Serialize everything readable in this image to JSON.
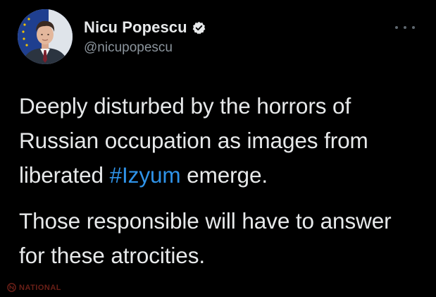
{
  "author": {
    "display_name": "Nicu Popescu",
    "handle": "@nicupopescu",
    "verified": true,
    "verified_icon": "verified-badge-icon",
    "avatar_icon": "profile-photo"
  },
  "more_icon": "more-options-icon",
  "tweet": {
    "paragraph_1": {
      "before": "Deeply disturbed by the horrors of Russian occupation as images from liberated ",
      "hashtag": "#Izyum",
      "after": " emerge."
    },
    "paragraph_2": "Those responsible will have to answer for these atrocities."
  },
  "watermark": {
    "text": "NATIONAL"
  },
  "colors": {
    "background": "#000000",
    "text": "#e7e9ea",
    "secondary_text": "#8b949c",
    "link": "#2f93e8",
    "watermark": "#c0392b"
  }
}
